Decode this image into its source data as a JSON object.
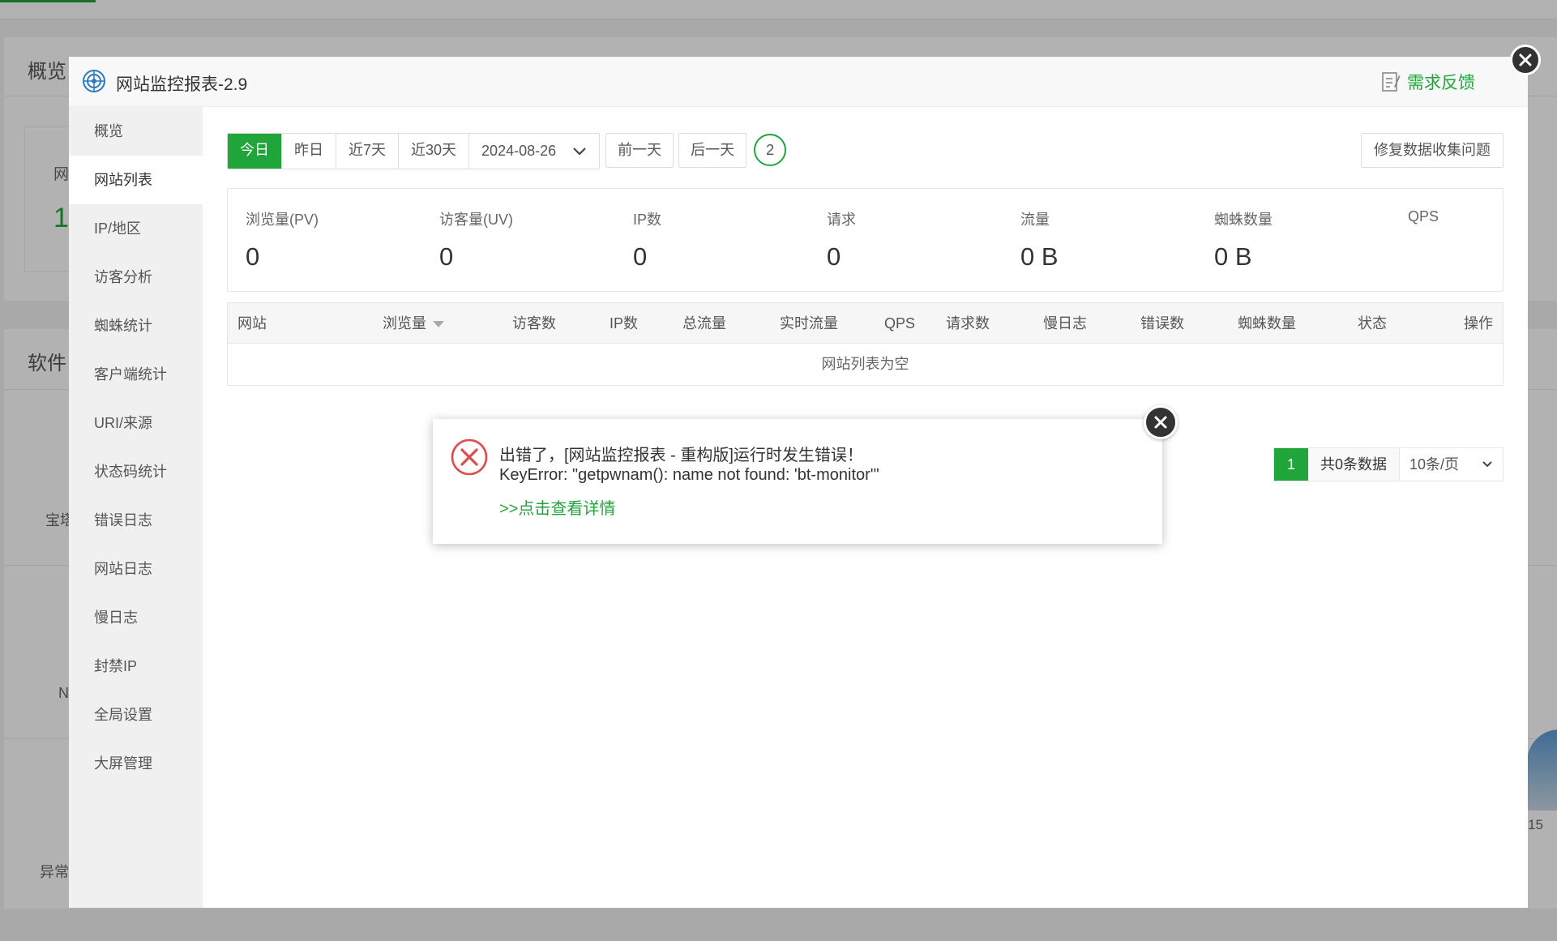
{
  "background": {
    "overview_title": "概览",
    "software_title": "软件",
    "fragment_wang": "网",
    "fragment_one": "1",
    "fragment_bao": "宝塔",
    "fragment_n": "N",
    "fragment_abnormal": "异常",
    "fragment_15": "15"
  },
  "modal": {
    "title": "网站监控报表-2.9",
    "feedback_label": "需求反馈"
  },
  "sidebar": {
    "items": [
      {
        "label": "概览"
      },
      {
        "label": "网站列表"
      },
      {
        "label": "IP/地区"
      },
      {
        "label": "访客分析"
      },
      {
        "label": "蜘蛛统计"
      },
      {
        "label": "客户端统计"
      },
      {
        "label": "URI/来源"
      },
      {
        "label": "状态码统计"
      },
      {
        "label": "错误日志"
      },
      {
        "label": "网站日志"
      },
      {
        "label": "慢日志"
      },
      {
        "label": "封禁IP"
      },
      {
        "label": "全局设置"
      },
      {
        "label": "大屏管理"
      }
    ],
    "active_index": 1
  },
  "toolbar": {
    "ranges": [
      "今日",
      "昨日",
      "近7天",
      "近30天"
    ],
    "active_range": "今日",
    "date_value": "2024-08-26",
    "prev_day": "前一天",
    "next_day": "后一天",
    "circle_count": "2",
    "fix_button": "修复数据收集问题"
  },
  "stats": [
    {
      "label": "浏览量(PV)",
      "value": "0"
    },
    {
      "label": "访客量(UV)",
      "value": "0"
    },
    {
      "label": "IP数",
      "value": "0"
    },
    {
      "label": "请求",
      "value": "0"
    },
    {
      "label": "流量",
      "value": "0 B"
    },
    {
      "label": "蜘蛛数量",
      "value": "0 B"
    },
    {
      "label": "QPS",
      "value": ""
    }
  ],
  "table": {
    "columns": [
      "网站",
      "浏览量",
      "访客数",
      "IP数",
      "总流量",
      "实时流量",
      "QPS",
      "请求数",
      "慢日志",
      "错误数",
      "蜘蛛数量",
      "状态",
      "操作"
    ],
    "sorted_column": "浏览量",
    "empty_text": "网站列表为空"
  },
  "pagination": {
    "current_page": "1",
    "total_text": "共0条数据",
    "page_size": "10条/页"
  },
  "error_dialog": {
    "title": "出错了，[网站监控报表 - 重构版]运行时发生错误！",
    "message": "KeyError: \"getpwnam(): name not found: 'bt-monitor'\"",
    "detail_link": ">>点击查看详情"
  },
  "colors": {
    "accent": "#20a53a",
    "error": "#e04b4b"
  }
}
